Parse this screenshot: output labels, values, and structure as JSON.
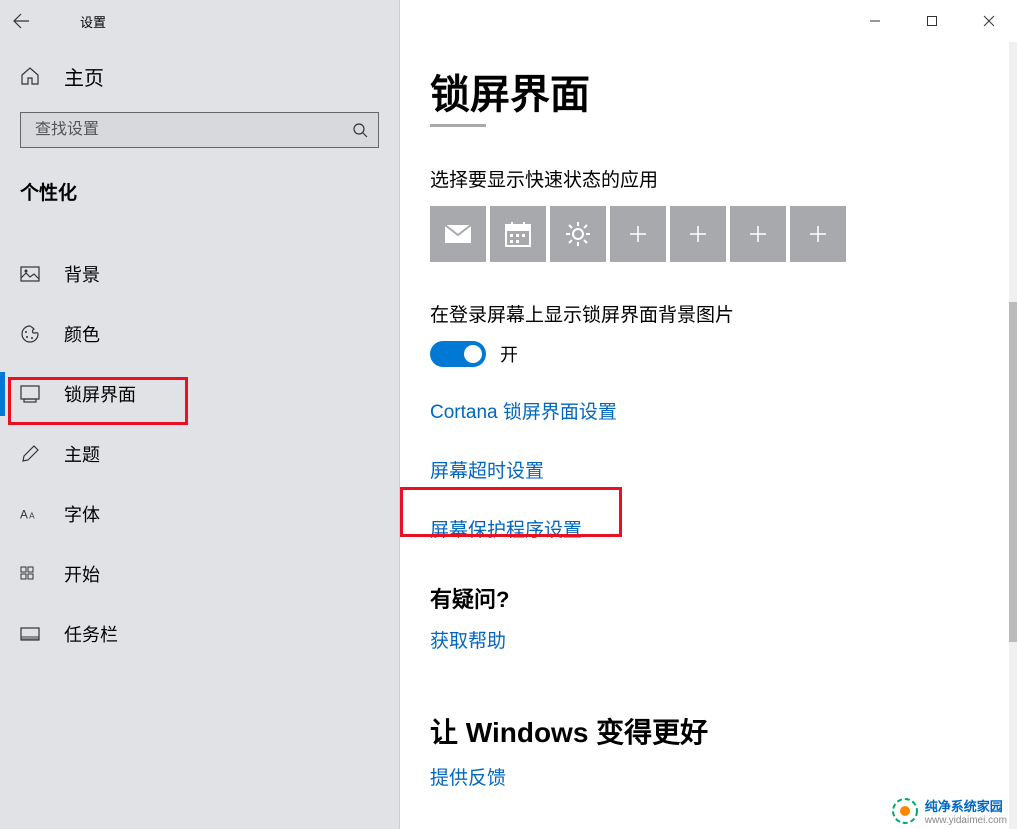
{
  "window": {
    "title": "设置"
  },
  "sidebar": {
    "home": "主页",
    "search_placeholder": "查找设置",
    "category": "个性化",
    "items": [
      {
        "label": "背景",
        "icon": "picture"
      },
      {
        "label": "颜色",
        "icon": "palette"
      },
      {
        "label": "锁屏界面",
        "icon": "lock-screen",
        "active": true
      },
      {
        "label": "主题",
        "icon": "brush"
      },
      {
        "label": "字体",
        "icon": "font"
      },
      {
        "label": "开始",
        "icon": "start"
      },
      {
        "label": "任务栏",
        "icon": "taskbar"
      }
    ]
  },
  "main": {
    "title": "锁屏界面",
    "quick_status_label": "选择要显示快速状态的应用",
    "tiles": [
      {
        "icon": "mail"
      },
      {
        "icon": "calendar"
      },
      {
        "icon": "weather"
      },
      {
        "icon": "plus"
      },
      {
        "icon": "plus"
      },
      {
        "icon": "plus"
      },
      {
        "icon": "plus"
      }
    ],
    "signin_bg_label": "在登录屏幕上显示锁屏界面背景图片",
    "toggle_state": "开",
    "links": {
      "cortana": "Cortana 锁屏界面设置",
      "timeout": "屏幕超时设置",
      "screensaver": "屏幕保护程序设置"
    },
    "help_heading": "有疑问?",
    "help_link": "获取帮助",
    "feedback_heading": "让 Windows 变得更好",
    "feedback_link": "提供反馈"
  },
  "watermark": {
    "line1": "纯净系统家园",
    "line2": "www.yidaimei.com"
  }
}
